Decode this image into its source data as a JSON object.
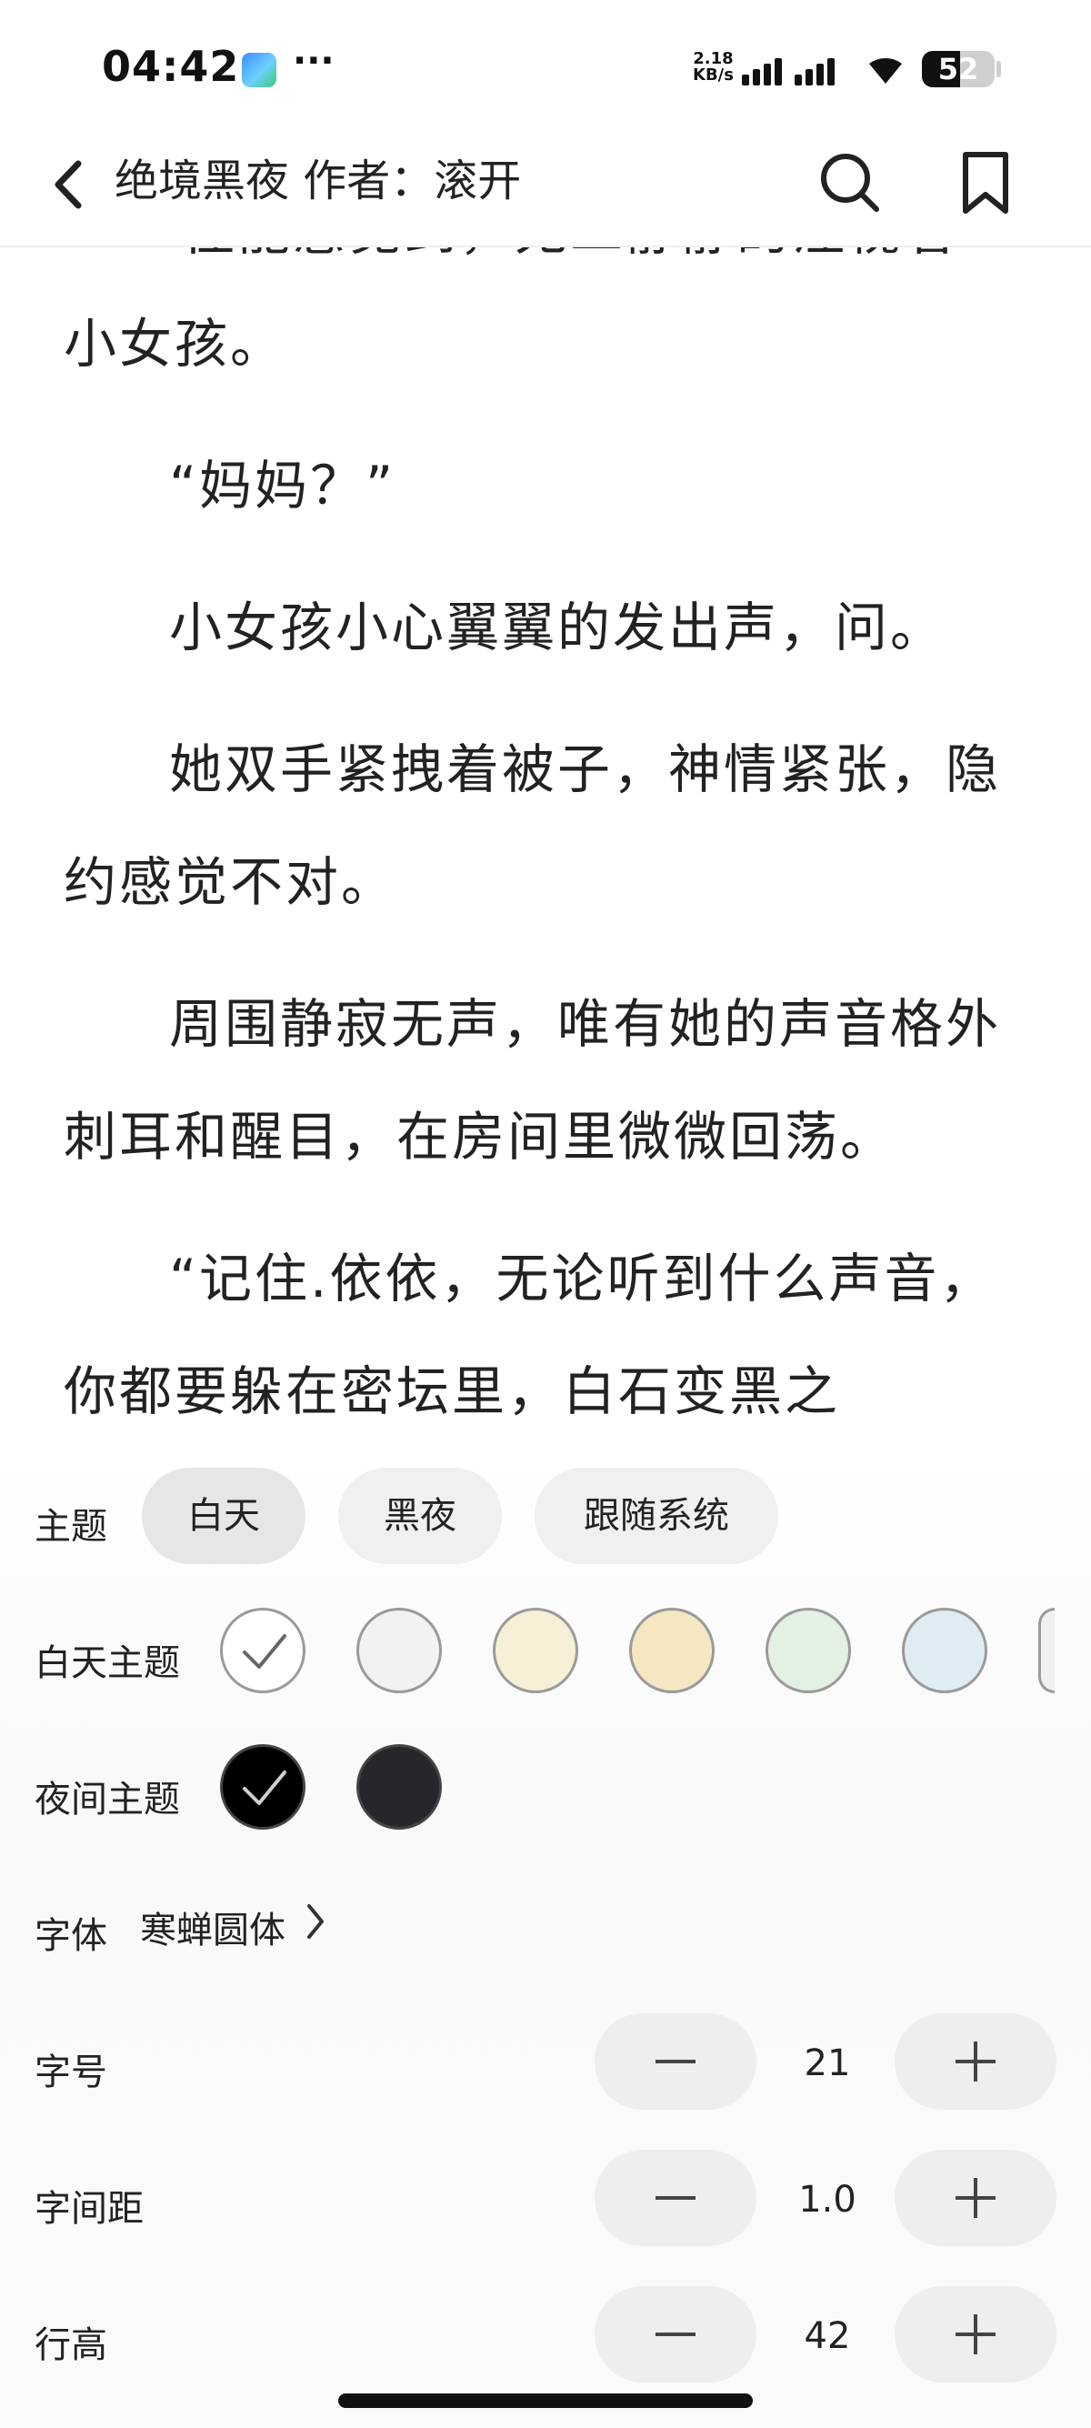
{
  "status_bar": {
    "time": "04:42",
    "more_glyph": "···",
    "net_speed_value": "2.18",
    "net_speed_unit": "KB/s",
    "battery_level": "52",
    "battery_fraction": 0.52
  },
  "header": {
    "title": "绝境黑夜 作者：滚开",
    "icons": [
      "back-icon",
      "search-icon",
      "bookmark-icon"
    ]
  },
  "content": {
    "partial_line": "往能感觉到，无二静静的注视着",
    "paragraphs": [
      {
        "text": "小女孩。",
        "indent": false
      },
      {
        "text": "“妈妈？”",
        "indent": true
      },
      {
        "text": "小女孩小心翼翼的发出声，问。",
        "indent": true
      },
      {
        "text": "她双手紧拽着被子，神情紧张，隐约感觉不对。",
        "indent": true
      },
      {
        "text": "周围静寂无声，唯有她的声音格外刺耳和醒目，在房间里微微回荡。",
        "indent": true
      },
      {
        "text": "“记住.依依，无论听到什么声音，你都要躲在密坛里，白石变黑之",
        "indent": true
      }
    ]
  },
  "settings": {
    "theme": {
      "label": "主题",
      "options": [
        "白天",
        "黑夜",
        "跟随系统"
      ],
      "selected": "白天"
    },
    "day_theme": {
      "label": "白天主题",
      "swatches": [
        "#ffffff",
        "#f2f2f2",
        "#f7f0d6",
        "#f5e7c2",
        "#e3f0e4",
        "#deecf3",
        "#f0f0f0"
      ],
      "selected_index": 0
    },
    "night_theme": {
      "label": "夜间主题",
      "swatches": [
        "#000000",
        "#25272a"
      ],
      "selected_index": 0
    },
    "font": {
      "label": "字体",
      "value": "寒蝉圆体"
    },
    "font_size": {
      "label": "字号",
      "value": "21"
    },
    "letter_spacing": {
      "label": "字间距",
      "value": "1.0"
    },
    "line_height": {
      "label": "行高",
      "value": "42"
    }
  },
  "colors": {
    "panel_bg": "#fafafa",
    "chip_bg": "#f0f0f0",
    "text": "#222222"
  }
}
